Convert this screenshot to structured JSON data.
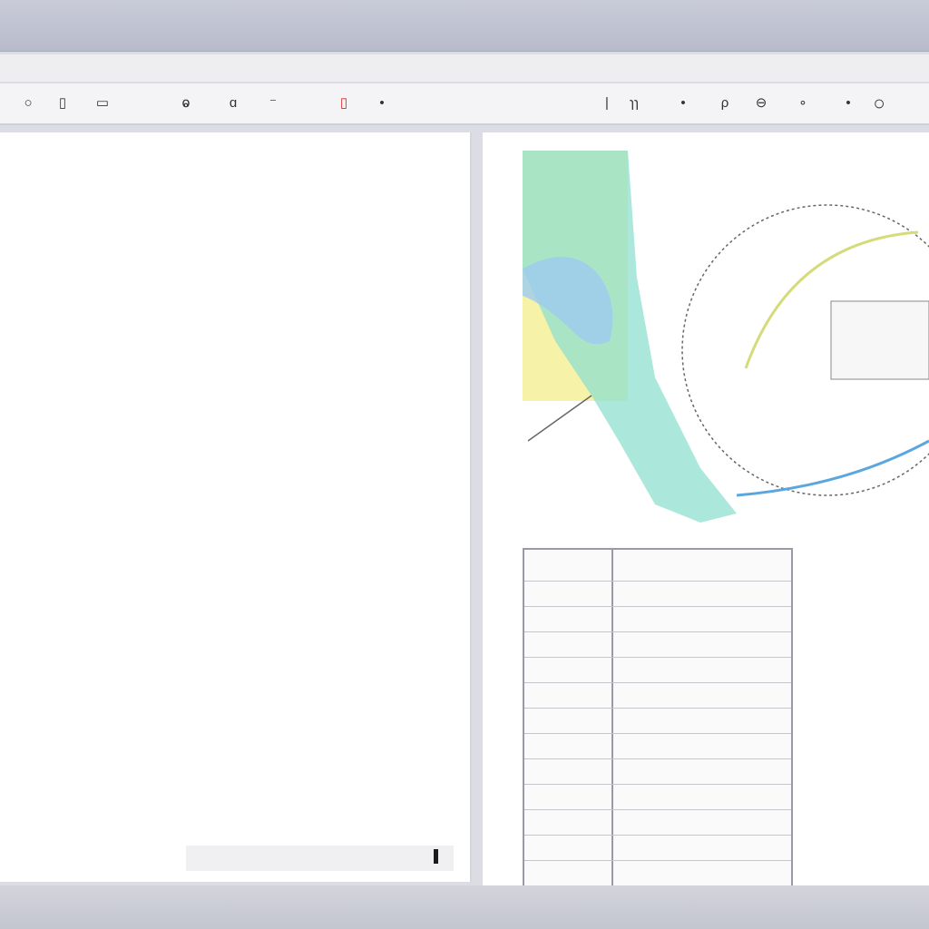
{
  "titlebar": {
    "title": ""
  },
  "menu": {
    "items": [
      "",
      "",
      ""
    ]
  },
  "toolbar": {
    "left_icons": [
      "open-icon",
      "columns-icon",
      "cut-icon",
      "copy-icon",
      "paste-icon",
      "red-marker-icon",
      "bullet-icon"
    ],
    "right_icons": [
      "cursor-icon",
      "scissors-icon",
      "zoom-icon",
      "circle-icon",
      "dot-icon",
      "ring-icon"
    ]
  },
  "document": {
    "lines": [
      "",
      "",
      "",
      "",
      "",
      "",
      "",
      "",
      "",
      "",
      "",
      "",
      "",
      "",
      "",
      "",
      "",
      ""
    ]
  },
  "figure": {
    "colors": {
      "yellow": "#f4f1a0",
      "teal": "#5fcfc2",
      "blue": "#7cb2e6",
      "curve": "#c9d77a"
    },
    "inset_label": ""
  },
  "table": {
    "headers": [
      "",
      ""
    ],
    "rows": [
      [
        "",
        ""
      ],
      [
        "",
        ""
      ],
      [
        "",
        ""
      ],
      [
        "",
        ""
      ],
      [
        "",
        ""
      ],
      [
        "",
        ""
      ],
      [
        "",
        ""
      ],
      [
        "",
        ""
      ],
      [
        "",
        ""
      ],
      [
        "",
        ""
      ],
      [
        "",
        ""
      ],
      [
        "",
        ""
      ]
    ]
  },
  "colors": {
    "panel_bg": "#ffffff",
    "chrome": "#c9cbd8",
    "border": "#9a9aa2"
  }
}
